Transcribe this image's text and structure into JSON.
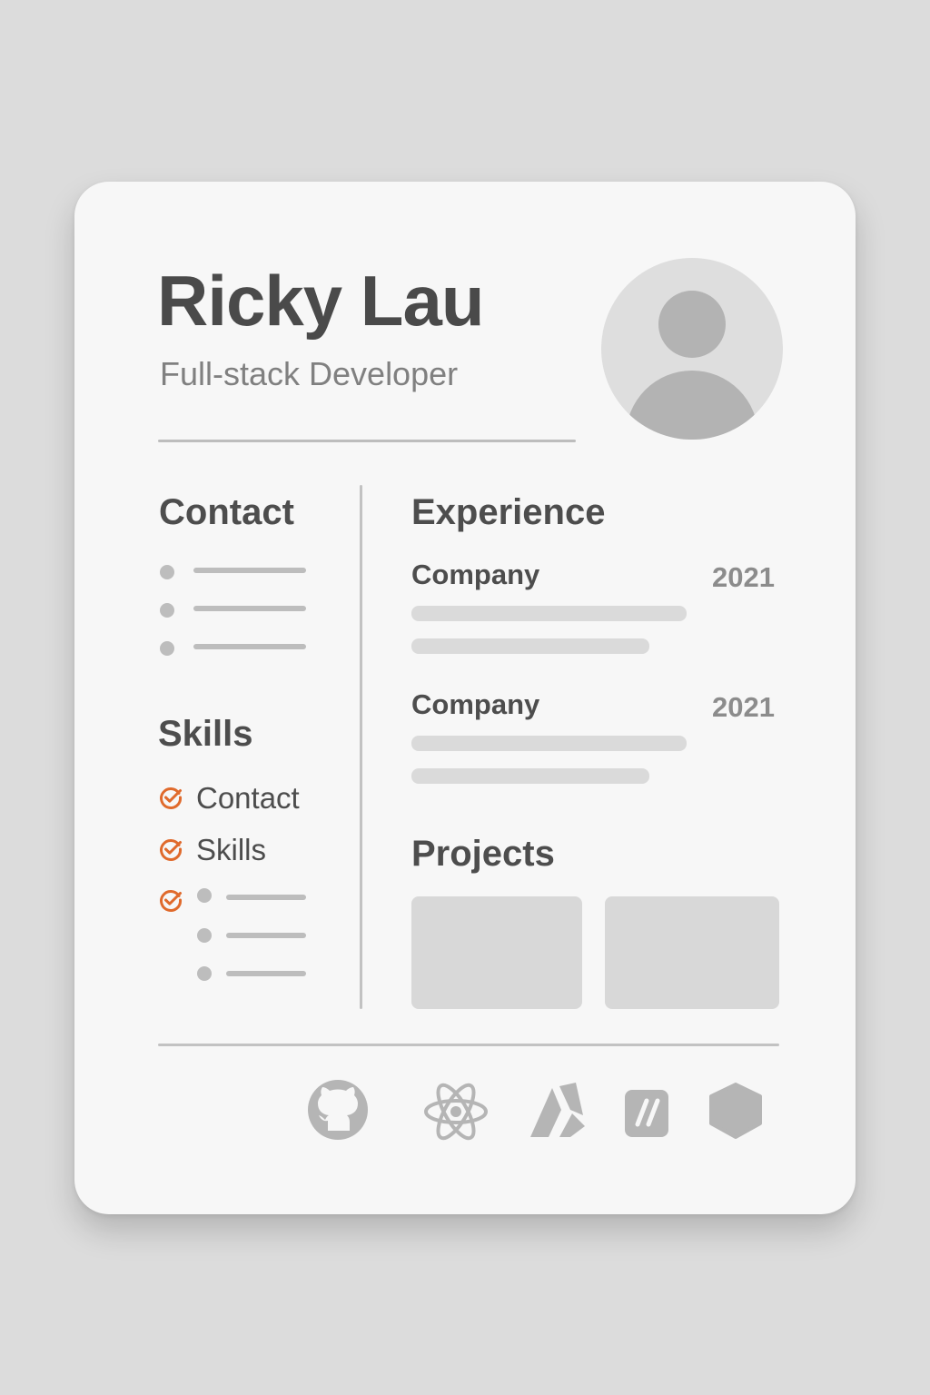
{
  "profile": {
    "name": "Ricky Lau",
    "role": "Full-stack Developer"
  },
  "contact": {
    "title": "Contact",
    "item_count_shown": 3
  },
  "skills": {
    "title": "Skills",
    "items": [
      "Contact",
      "Skills"
    ]
  },
  "experience": {
    "title": "Experience",
    "entries": [
      {
        "company": "Company",
        "year": "2021"
      },
      {
        "company": "Company",
        "year": "2021"
      }
    ]
  },
  "projects": {
    "title": "Projects"
  },
  "tech_icons": [
    "github-icon",
    "react-atom-icon",
    "angular-like-icon",
    "slash-badge-icon",
    "hexagon-icon"
  ],
  "colors": {
    "accent_check": "#e06a2c",
    "text_dark": "#4a4a4a",
    "text_muted": "#808080",
    "placeholder": "#bdbdbd",
    "card_bg": "#f7f7f7",
    "page_bg": "#dcdcdc"
  }
}
